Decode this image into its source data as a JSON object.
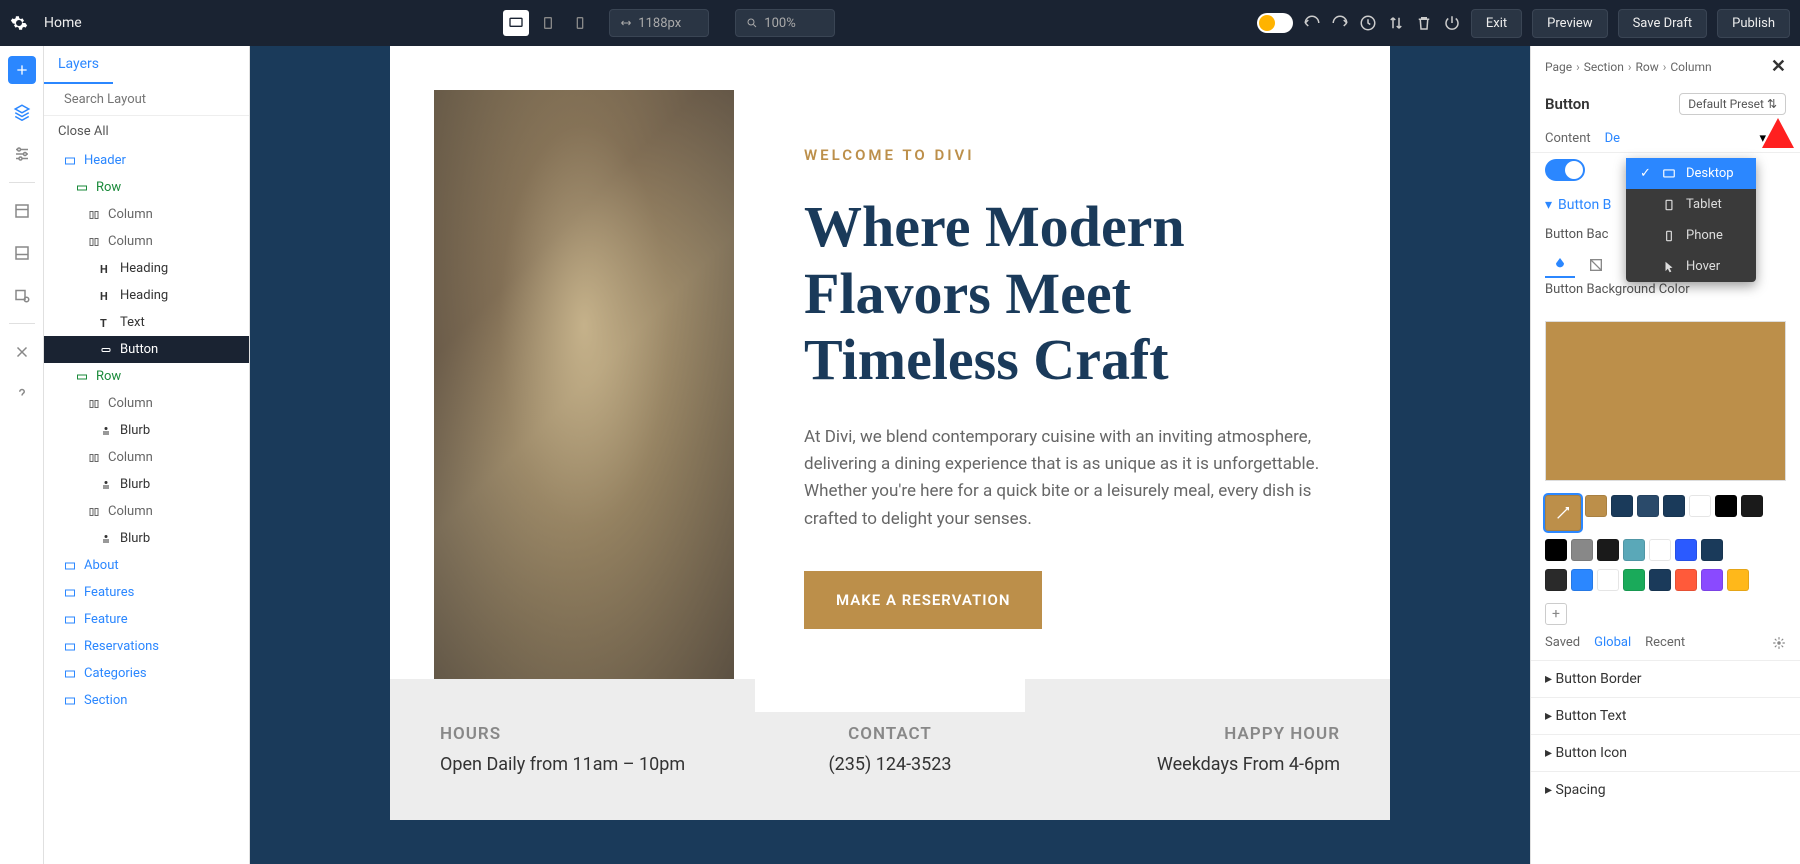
{
  "topbar": {
    "title": "Home",
    "width_value": "1188px",
    "zoom_value": "100%",
    "exit": "Exit",
    "preview": "Preview",
    "save_draft": "Save Draft",
    "publish": "Publish"
  },
  "layers": {
    "tab_label": "Layers",
    "search_placeholder": "Search Layout",
    "close_all": "Close All",
    "tree": [
      {
        "type": "section",
        "label": "Header"
      },
      {
        "type": "row",
        "label": "Row"
      },
      {
        "type": "col",
        "label": "Column"
      },
      {
        "type": "col",
        "label": "Column"
      },
      {
        "type": "module",
        "icon": "H",
        "label": "Heading"
      },
      {
        "type": "module",
        "icon": "H",
        "label": "Heading"
      },
      {
        "type": "module",
        "icon": "T",
        "label": "Text"
      },
      {
        "type": "module",
        "icon": "btn",
        "label": "Button",
        "selected": true
      },
      {
        "type": "row",
        "label": "Row"
      },
      {
        "type": "col",
        "label": "Column"
      },
      {
        "type": "module",
        "icon": "blurb",
        "label": "Blurb"
      },
      {
        "type": "col",
        "label": "Column"
      },
      {
        "type": "module",
        "icon": "blurb",
        "label": "Blurb"
      },
      {
        "type": "col",
        "label": "Column"
      },
      {
        "type": "module",
        "icon": "blurb",
        "label": "Blurb"
      },
      {
        "type": "section",
        "label": "About"
      },
      {
        "type": "section",
        "label": "Features"
      },
      {
        "type": "section",
        "label": "Feature"
      },
      {
        "type": "section",
        "label": "Reservations"
      },
      {
        "type": "section",
        "label": "Categories"
      },
      {
        "type": "section",
        "label": "Section"
      }
    ]
  },
  "canvas": {
    "welcome": "WELCOME TO DIVI",
    "title": "Where Modern Flavors Meet Timeless Craft",
    "desc": "At Divi, we blend contemporary cuisine with an inviting atmosphere, delivering a dining experience that is as unique as it is unforgettable. Whether you're here for a quick bite or a leisurely meal, every dish is crafted to delight your senses.",
    "cta": "MAKE A RESERVATION",
    "info": {
      "hours_label": "HOURS",
      "hours_value": "Open Daily from 11am – 10pm",
      "contact_label": "CONTACT",
      "contact_value": "(235) 124-3523",
      "happy_label": "HAPPY HOUR",
      "happy_value": "Weekdays From 4-6pm"
    }
  },
  "rpanel": {
    "crumbs": [
      "Page",
      "Section",
      "Row",
      "Column"
    ],
    "title": "Button",
    "preset": "Default Preset",
    "tabs": {
      "content": "Content",
      "design": "De"
    },
    "section_bg": "Button B",
    "field_bg_label": "Button Bac",
    "field_bg_color_label": "Button Background Color",
    "current_color": "#bc8f4a",
    "swatches_row1": [
      "#bc8f4a",
      "#1a3a5a",
      "#2a4a6a",
      "#1a3a5a",
      "#ffffff",
      "#000000",
      "#1a1a1a"
    ],
    "swatches_row2": [
      "#000000",
      "#888888",
      "#1a1a1a",
      "#5aa8b8",
      "#ffffff",
      "#2b5aff",
      "#1a3a5a"
    ],
    "swatches_row3": [
      "#2a2a2a",
      "#2b87ff",
      "#ffffff",
      "#1aaa5a",
      "#1a3a5a",
      "#ff5a3a",
      "#8a4aff",
      "#ffb81a"
    ],
    "palette_saved": "Saved",
    "palette_global": "Global",
    "palette_recent": "Recent",
    "collapsed": [
      "Button Border",
      "Button Text",
      "Button Icon",
      "Spacing"
    ]
  },
  "device_dropdown": {
    "items": [
      {
        "label": "Desktop",
        "active": true,
        "icon": "desktop"
      },
      {
        "label": "Tablet",
        "icon": "tablet"
      },
      {
        "label": "Phone",
        "icon": "phone"
      },
      {
        "label": "Hover",
        "icon": "cursor"
      }
    ]
  }
}
